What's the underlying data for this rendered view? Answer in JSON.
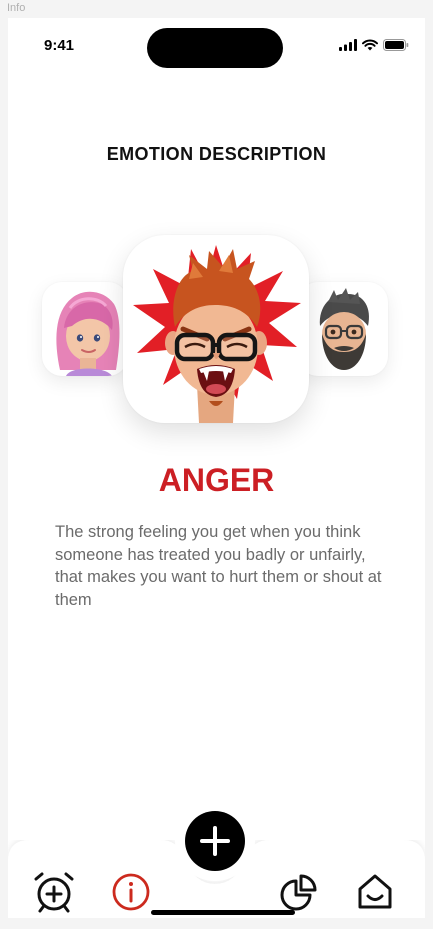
{
  "frame_label": "Info",
  "status_bar": {
    "time": "9:41",
    "icons": [
      "signal-icon",
      "wifi-icon",
      "battery-icon"
    ]
  },
  "page": {
    "title": "EMOTION DESCRIPTION"
  },
  "carousel": {
    "items": [
      {
        "avatar": "pink-haired-memoji",
        "position": "previous"
      },
      {
        "avatar": "angry-red-haired-memoji",
        "position": "current"
      },
      {
        "avatar": "bearded-memoji",
        "position": "next"
      }
    ]
  },
  "emotion": {
    "name": "ANGER",
    "description": "The strong feeling you get when you think someone has treated you badly or unfairly, that makes you want to hurt them or shout at them",
    "color": "#cc1f24"
  },
  "tab_bar": {
    "items": [
      {
        "icon": "alarm-add-icon",
        "active": false
      },
      {
        "icon": "info-icon",
        "active": true
      },
      {
        "icon": "add-icon",
        "primary": true
      },
      {
        "icon": "pie-chart-icon",
        "active": false
      },
      {
        "icon": "home-icon",
        "active": false
      }
    ],
    "active_color": "#cc2a1e"
  }
}
